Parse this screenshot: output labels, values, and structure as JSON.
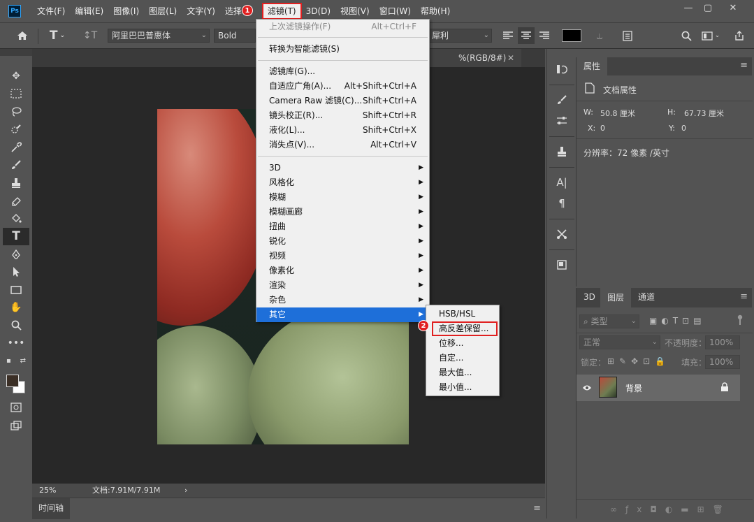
{
  "menubar": {
    "items": [
      "文件(F)",
      "编辑(E)",
      "图像(I)",
      "图层(L)",
      "文字(Y)",
      "选择",
      "滤镜(T)",
      "3D(D)",
      "视图(V)",
      "窗口(W)",
      "帮助(H)"
    ],
    "logo": "Ps"
  },
  "window_controls": [
    "—",
    "▢",
    "✕"
  ],
  "options_bar": {
    "font_family": "阿里巴巴普惠体",
    "font_style": "Bold",
    "antialias": "犀利"
  },
  "document": {
    "tab_label": "%(RGB/8#)",
    "tab_close": "✕"
  },
  "status": {
    "zoom": "25%",
    "doc_size": "文档:7.91M/7.91M",
    "arrow": "›"
  },
  "timeline": {
    "label": "时间轴"
  },
  "properties": {
    "tab": "属性",
    "section": "文档属性",
    "w_label": "W:",
    "w_value": "50.8 厘米",
    "h_label": "H:",
    "h_value": "67.73 厘米",
    "x_label": "X:",
    "x_value": "0",
    "y_label": "Y:",
    "y_value": "0",
    "resolution": "分辨率：72 像素 /英寸"
  },
  "layers_panel": {
    "tabs": [
      "3D",
      "图层",
      "通道"
    ],
    "filter_placeholder": "类型",
    "blend_mode": "正常",
    "opacity_label": "不透明度：",
    "opacity_value": "100%",
    "lock_label": "锁定：",
    "fill_label": "填充：",
    "fill_value": "100%",
    "layer_name": "背景"
  },
  "filter_menu": {
    "last_filter": "上次滤镜操作(F)",
    "last_filter_shortcut": "Alt+Ctrl+F",
    "smart_filter": "转换为智能滤镜(S)",
    "items": [
      {
        "label": "滤镜库(G)...",
        "shortcut": ""
      },
      {
        "label": "自适应广角(A)...",
        "shortcut": "Alt+Shift+Ctrl+A"
      },
      {
        "label": "Camera Raw 滤镜(C)...",
        "shortcut": "Shift+Ctrl+A"
      },
      {
        "label": "镜头校正(R)...",
        "shortcut": "Shift+Ctrl+R"
      },
      {
        "label": "液化(L)...",
        "shortcut": "Shift+Ctrl+X"
      },
      {
        "label": "消失点(V)...",
        "shortcut": "Alt+Ctrl+V"
      }
    ],
    "submenus": [
      "3D",
      "风格化",
      "模糊",
      "模糊画廊",
      "扭曲",
      "锐化",
      "视频",
      "像素化",
      "渲染",
      "杂色",
      "其它"
    ]
  },
  "other_submenu": [
    "HSB/HSL",
    "高反差保留...",
    "位移...",
    "自定...",
    "最大值...",
    "最小值..."
  ],
  "annotations": [
    "1",
    "2"
  ],
  "colors": {
    "highlight": "#1e6fd9",
    "callout": "#e02020",
    "ui_bg": "#535353"
  }
}
